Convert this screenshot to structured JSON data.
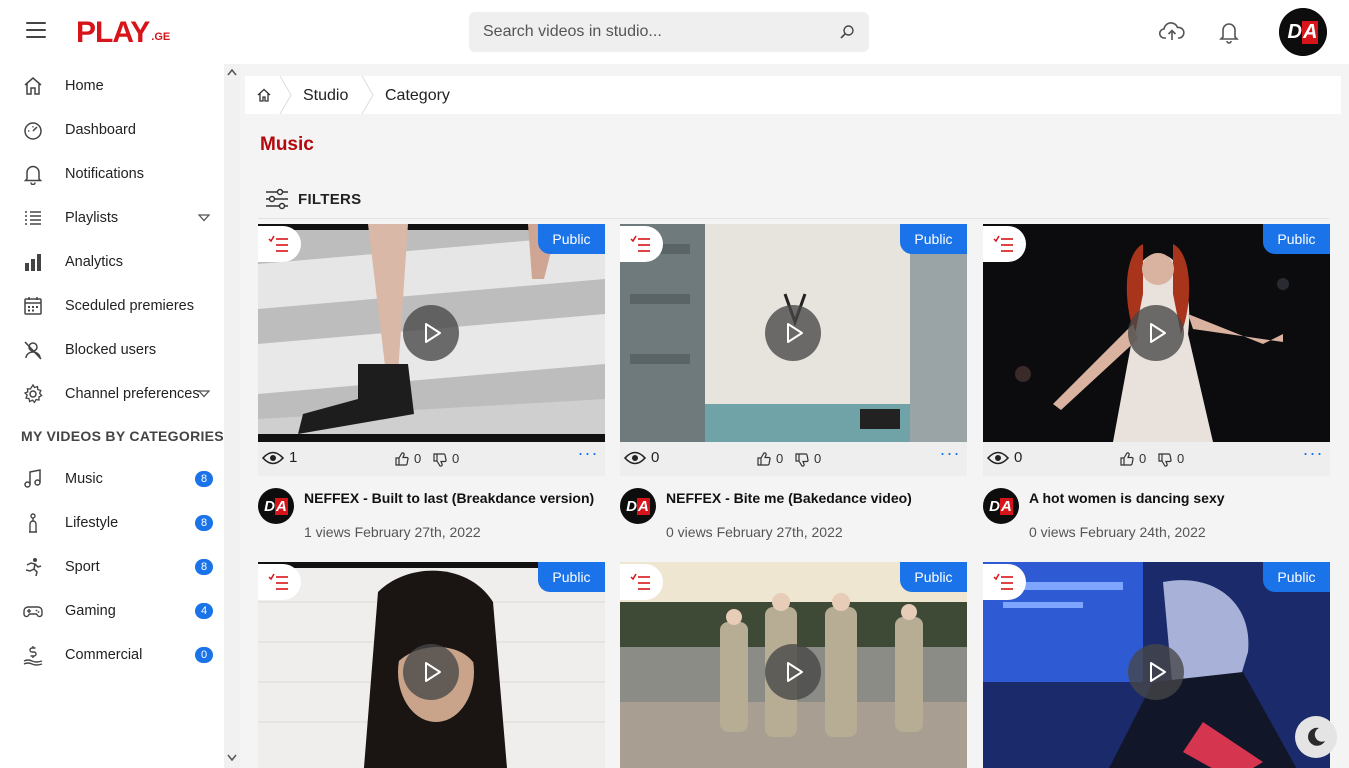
{
  "header": {
    "logo_text": "PLAY",
    "logo_suffix": ".GE",
    "search_placeholder": "Search videos in studio..."
  },
  "user": {
    "avatar_initials_d": "D",
    "avatar_initials_a": "A"
  },
  "sidebar": {
    "items": [
      {
        "label": "Home",
        "icon": "home-icon"
      },
      {
        "label": "Dashboard",
        "icon": "dashboard-icon"
      },
      {
        "label": "Notifications",
        "icon": "bell-icon"
      },
      {
        "label": "Playlists",
        "icon": "playlist-icon"
      },
      {
        "label": "Analytics",
        "icon": "chart-icon"
      },
      {
        "label": "Sceduled premieres",
        "icon": "calendar-icon"
      },
      {
        "label": "Blocked users",
        "icon": "blocked-user-icon"
      },
      {
        "label": "Channel preferences",
        "icon": "gear-icon"
      }
    ],
    "section_title": "MY VIDEOS BY CATEGORIES",
    "categories": [
      {
        "label": "Music",
        "count": "8",
        "icon": "music-note-icon"
      },
      {
        "label": "Lifestyle",
        "count": "8",
        "icon": "lifestyle-icon"
      },
      {
        "label": "Sport",
        "count": "8",
        "icon": "running-icon"
      },
      {
        "label": "Gaming",
        "count": "4",
        "icon": "gamepad-icon"
      },
      {
        "label": "Commercial",
        "count": "0",
        "icon": "money-icon"
      }
    ]
  },
  "breadcrumb": {
    "items": [
      "Studio",
      "Category"
    ]
  },
  "page": {
    "title": "Music",
    "filters_label": "FILTERS"
  },
  "videos": [
    {
      "visibility": "Public",
      "views": "1",
      "likes": "0",
      "dislikes": "0",
      "title": "NEFFEX - Built to last (Breakdance version)",
      "meta": "1 views February 27th, 2022"
    },
    {
      "visibility": "Public",
      "views": "0",
      "likes": "0",
      "dislikes": "0",
      "title": "NEFFEX - Bite me (Bakedance video)",
      "meta": "0 views February 27th, 2022"
    },
    {
      "visibility": "Public",
      "views": "0",
      "likes": "0",
      "dislikes": "0",
      "title": "A hot women is dancing sexy",
      "meta": "0 views February 24th, 2022"
    },
    {
      "visibility": "Public"
    },
    {
      "visibility": "Public"
    },
    {
      "visibility": "Public"
    }
  ],
  "more_label": "···",
  "colors": {
    "brand_red": "#d7141a",
    "title_red": "#b3080d",
    "accent_blue": "#1a73e8"
  }
}
